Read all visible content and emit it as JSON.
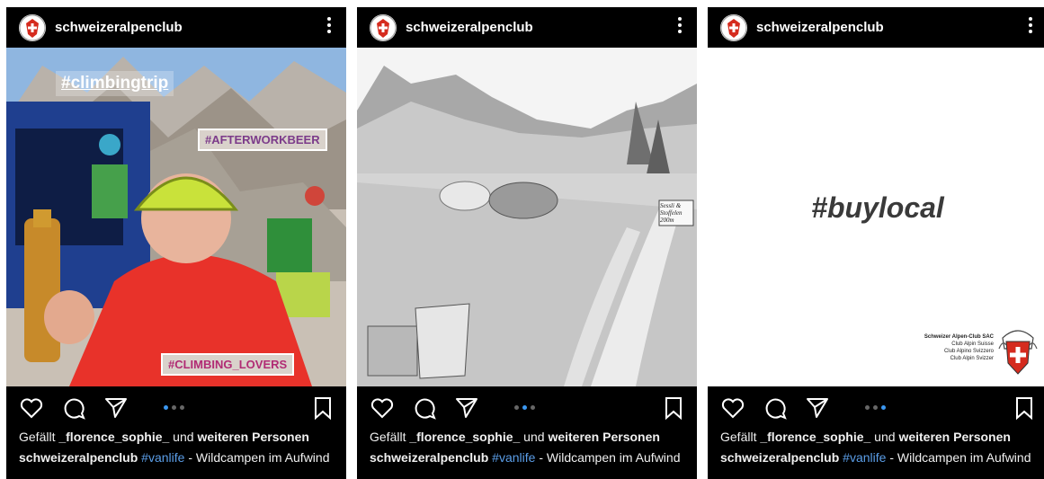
{
  "posts": [
    {
      "username": "schweizeralpenclub",
      "overlays": [
        "#climbingtrip",
        "#AFTERWORKBEER",
        "#CLIMBING_LOVERS"
      ],
      "likes": {
        "prefix": "Gefällt ",
        "user": "_florence_sophie_",
        "middle": " und ",
        "rest": "weiteren Personen"
      },
      "caption": {
        "user": "schweizeralpenclub",
        "hashtag": "#vanlife",
        "text": " - Wildcampen im Aufwind"
      },
      "carousel_active": 1,
      "carousel_count": 3
    },
    {
      "username": "schweizeralpenclub",
      "sign_text": "Sessli & Stoffelen 200m",
      "likes": {
        "prefix": "Gefällt ",
        "user": "_florence_sophie_",
        "middle": " und ",
        "rest": "weiteren Personen"
      },
      "caption": {
        "user": "schweizeralpenclub",
        "hashtag": "#vanlife",
        "text": " - Wildcampen im Aufwind"
      },
      "carousel_active": 2,
      "carousel_count": 3
    },
    {
      "username": "schweizeralpenclub",
      "headline": "#buylocal",
      "logo_text": [
        "Schweizer Alpen-Club SAC",
        "Club Alpin Suisse",
        "Club Alpino Svizzero",
        "Club Alpin Svizzer"
      ],
      "likes": {
        "prefix": "Gefällt ",
        "user": "_florence_sophie_",
        "middle": " und ",
        "rest": "weiteren Personen"
      },
      "caption": {
        "user": "schweizeralpenclub",
        "hashtag": "#vanlife",
        "text": " - Wildcampen im Aufwind"
      },
      "carousel_active": 3,
      "carousel_count": 3
    }
  ],
  "colors": {
    "background": "#000000",
    "link": "#5b9ee8",
    "dot_active": "#3b97f0",
    "swiss_red": "#d52b1e"
  },
  "icons": [
    "heart-icon",
    "comment-icon",
    "share-icon",
    "bookmark-icon",
    "more-icon",
    "sac-logo-icon"
  ]
}
